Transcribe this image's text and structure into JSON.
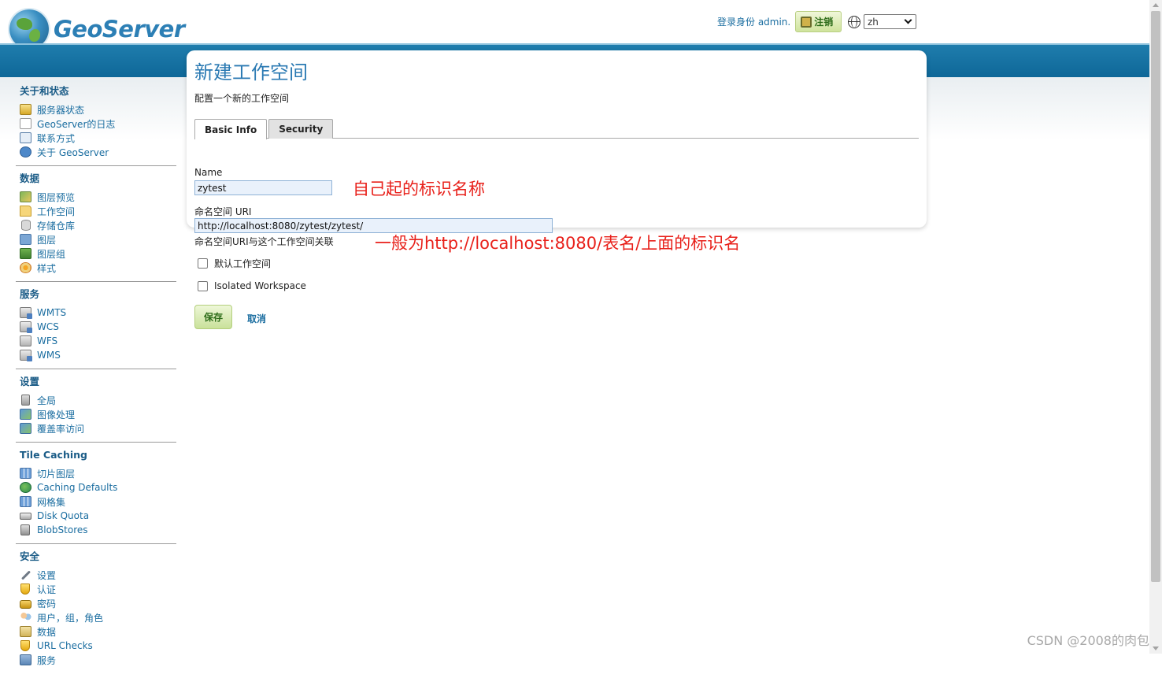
{
  "header": {
    "logo_text": "GeoServer",
    "login_label": "登录身份 admin.",
    "logout_label": "注销",
    "language": "zh"
  },
  "sidebar": {
    "sections": [
      {
        "title": "关于和状态",
        "items": [
          {
            "label": "服务器状态",
            "icon": "status-icon"
          },
          {
            "label": "GeoServer的日志",
            "icon": "log-icon"
          },
          {
            "label": "联系方式",
            "icon": "contact-icon"
          },
          {
            "label": "关于 GeoServer",
            "icon": "about-icon"
          }
        ]
      },
      {
        "title": "数据",
        "items": [
          {
            "label": "图层预览",
            "icon": "layer-preview-icon"
          },
          {
            "label": "工作空间",
            "icon": "folder-icon"
          },
          {
            "label": "存储仓库",
            "icon": "store-icon"
          },
          {
            "label": "图层",
            "icon": "layer-icon"
          },
          {
            "label": "图层组",
            "icon": "layer-group-icon"
          },
          {
            "label": "样式",
            "icon": "style-icon"
          }
        ]
      },
      {
        "title": "服务",
        "items": [
          {
            "label": "WMTS",
            "icon": "service-icon"
          },
          {
            "label": "WCS",
            "icon": "service-icon"
          },
          {
            "label": "WFS",
            "icon": "service-icon"
          },
          {
            "label": "WMS",
            "icon": "service-icon"
          }
        ]
      },
      {
        "title": "设置",
        "items": [
          {
            "label": "全局",
            "icon": "global-icon"
          },
          {
            "label": "图像处理",
            "icon": "image-icon"
          },
          {
            "label": "覆盖率访问",
            "icon": "coverage-icon"
          }
        ]
      },
      {
        "title": "Tile Caching",
        "items": [
          {
            "label": "切片图层",
            "icon": "tile-layer-icon"
          },
          {
            "label": "Caching Defaults",
            "icon": "world-icon"
          },
          {
            "label": "网格集",
            "icon": "grid-icon"
          },
          {
            "label": "Disk Quota",
            "icon": "disk-icon"
          },
          {
            "label": "BlobStores",
            "icon": "blobstore-icon"
          }
        ]
      },
      {
        "title": "安全",
        "items": [
          {
            "label": "设置",
            "icon": "wrench-icon"
          },
          {
            "label": "认证",
            "icon": "shield-icon"
          },
          {
            "label": "密码",
            "icon": "lock-icon"
          },
          {
            "label": "用户，组，角色",
            "icon": "users-icon"
          },
          {
            "label": "数据",
            "icon": "data-icon"
          },
          {
            "label": "URL Checks",
            "icon": "shield-icon"
          },
          {
            "label": "服务",
            "icon": "service-security-icon"
          }
        ]
      }
    ]
  },
  "main": {
    "title": "新建工作空间",
    "subtitle": "配置一个新的工作空间",
    "tabs": [
      {
        "label": "Basic Info",
        "active": true
      },
      {
        "label": "Security",
        "active": false
      }
    ],
    "name_label": "Name",
    "name_value": "zytest",
    "uri_label": "命名空间 URI",
    "uri_value": "http://localhost:8080/zytest/zytest/",
    "uri_help": "命名空间URI与这个工作空间关联",
    "default_ws_label": "默认工作空间",
    "isolated_ws_label": "Isolated Workspace",
    "save_label": "保存",
    "cancel_label": "取消"
  },
  "annotations": {
    "name_note": "自己起的标识名称",
    "uri_note": "一般为http://localhost:8080/表名/上面的标识名"
  },
  "watermark": "CSDN @2008的肉包"
}
